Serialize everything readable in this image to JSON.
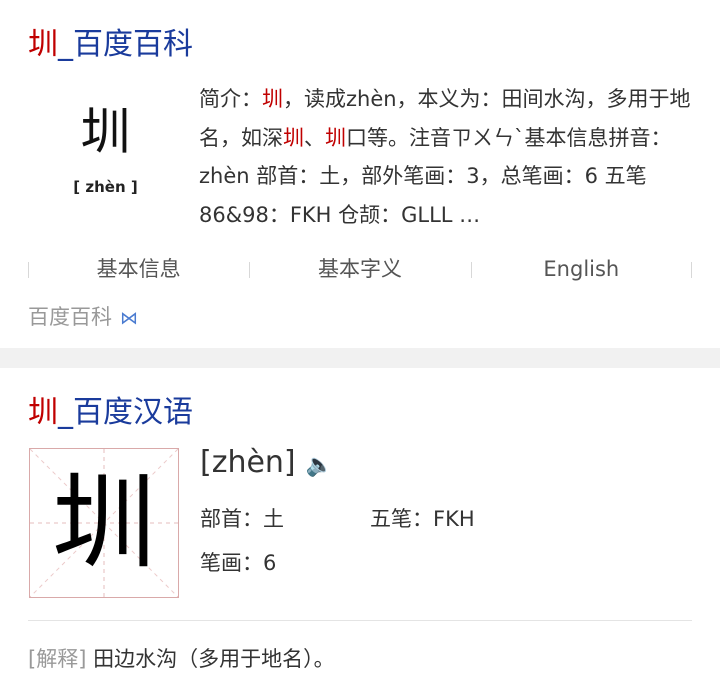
{
  "baike": {
    "title_char": "圳",
    "title_rest": "_百度百科",
    "thumb_char": "圳",
    "thumb_pinyin": "[ zhèn ]",
    "summary": [
      {
        "t": "简介："
      },
      {
        "t": "圳",
        "hl": true
      },
      {
        "t": "，读成zhèn，本义为：田间水沟，多用于地名，如深"
      },
      {
        "t": "圳",
        "hl": true
      },
      {
        "t": "、"
      },
      {
        "t": "圳",
        "hl": true
      },
      {
        "t": "口等。注音ㄗㄨㄣˋ基本信息拼音：zhèn 部首：土，部外笔画：3，总笔画：6 五笔86&98：FKH 仓颉：GLLL …"
      }
    ],
    "tabs": [
      "基本信息",
      "基本字义",
      "English"
    ],
    "source": "百度百科"
  },
  "hanyu": {
    "title_char": "圳",
    "title_rest": "_百度汉语",
    "char": "圳",
    "pinyin": "[zhèn]",
    "radical": "部首：土",
    "wubi": "五笔：FKH",
    "strokes": "笔画：6",
    "explain_tag": "[解释]",
    "explain_text": " 田边水沟（多用于地名）。"
  }
}
